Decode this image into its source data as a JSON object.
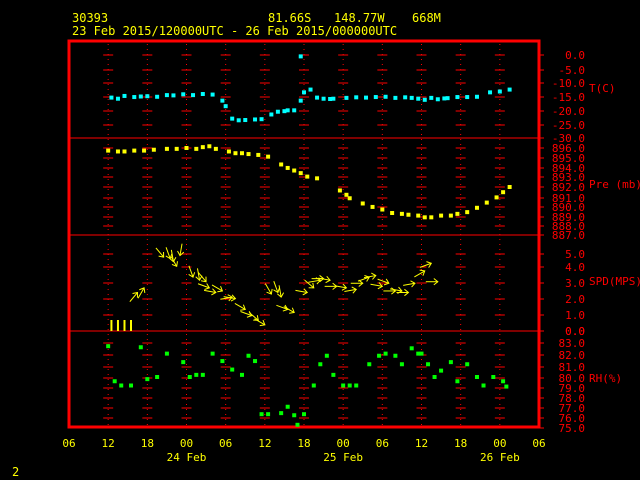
{
  "header": {
    "station_id": "30393",
    "lat": "81.66S",
    "lon": "148.77W",
    "elev": "668M",
    "time_range": "23 Feb 2015/120000UTC - 26 Feb 2015/000000UTC"
  },
  "footer": {
    "page_number": "2"
  },
  "colors": {
    "axes": "#ff0000",
    "text": "#ffff00",
    "temperature": "#00ffff",
    "pressure": "#ffff00",
    "wind": "#ffff00",
    "rh": "#00ff00"
  },
  "chart_data": {
    "type": "multi-panel time series",
    "x_axis": {
      "tick_labels": [
        "06",
        "12",
        "18",
        "00",
        "06",
        "12",
        "18",
        "00",
        "06",
        "12",
        "18",
        "00",
        "06"
      ],
      "day_labels": [
        "24 Feb",
        "25 Feb",
        "26 Feb"
      ]
    },
    "panels": [
      {
        "name": "temperature",
        "label": "T(C)",
        "ylim": [
          -30,
          0
        ],
        "tick_labels": [
          "0.0",
          "-5.0",
          "-10.0",
          "-15.0",
          "-20.0",
          "-25.0",
          "-30.0"
        ],
        "points": [
          [
            12.5,
            -15.4
          ],
          [
            13.5,
            -15.8
          ],
          [
            14.5,
            -14.8
          ],
          [
            16,
            -15.2
          ],
          [
            17,
            -15.0
          ],
          [
            18,
            -14.9
          ],
          [
            19.5,
            -15.1
          ],
          [
            21,
            -14.5
          ],
          [
            22,
            -14.6
          ],
          [
            23.5,
            -14.2
          ],
          [
            25,
            -14.5
          ],
          [
            26.5,
            -14.1
          ],
          [
            28,
            -14.3
          ],
          [
            29.5,
            -16.5
          ],
          [
            30,
            -18.5
          ],
          [
            31,
            -23
          ],
          [
            32,
            -23.6
          ],
          [
            33,
            -23.5
          ],
          [
            34.5,
            -23.3
          ],
          [
            35.5,
            -23.2
          ],
          [
            37,
            -21.5
          ],
          [
            38,
            -20.5
          ],
          [
            39,
            -20.3
          ],
          [
            39.5,
            -20
          ],
          [
            40.5,
            -20
          ],
          [
            41.5,
            -16.5
          ],
          [
            42,
            -13.5
          ],
          [
            43,
            -12.5
          ],
          [
            44,
            -15.4
          ],
          [
            45,
            -15.8
          ],
          [
            46,
            -15.9
          ],
          [
            46.5,
            -15.8
          ],
          [
            48.5,
            -15.5
          ],
          [
            50,
            -15.3
          ],
          [
            51.5,
            -15.4
          ],
          [
            53,
            -15.2
          ],
          [
            54.5,
            -15.1
          ],
          [
            56,
            -15.5
          ],
          [
            57.5,
            -15.3
          ],
          [
            58.5,
            -15.5
          ],
          [
            59.5,
            -15.8
          ],
          [
            60.5,
            -16.2
          ],
          [
            61.5,
            -15.5
          ],
          [
            62.5,
            -16.0
          ],
          [
            63.5,
            -15.7
          ],
          [
            64,
            -15.6
          ],
          [
            65.5,
            -15.2
          ],
          [
            67,
            -15.2
          ],
          [
            68.5,
            -15.1
          ],
          [
            70.5,
            -13.5
          ],
          [
            72,
            -13.2
          ],
          [
            73.5,
            -12.5
          ],
          [
            41.5,
            -0.5
          ]
        ]
      },
      {
        "name": "pressure",
        "label": "Pre (mb)",
        "ylim": [
          887,
          896
        ],
        "tick_labels": [
          "896.0",
          "895.0",
          "894.0",
          "893.0",
          "892.0",
          "891.0",
          "890.0",
          "889.0",
          "888.0",
          "887.0"
        ],
        "points": [
          [
            12,
            895.7
          ],
          [
            13.5,
            895.6
          ],
          [
            14.5,
            895.6
          ],
          [
            16,
            895.7
          ],
          [
            17.5,
            895.7
          ],
          [
            19,
            895.8
          ],
          [
            21,
            895.9
          ],
          [
            22.5,
            895.9
          ],
          [
            24,
            896.0
          ],
          [
            25.5,
            895.9
          ],
          [
            26.5,
            896.1
          ],
          [
            27.5,
            896.2
          ],
          [
            28.5,
            895.9
          ],
          [
            30.5,
            895.6
          ],
          [
            31.5,
            895.4
          ],
          [
            32.5,
            895.4
          ],
          [
            33.5,
            895.3
          ],
          [
            35,
            895.2
          ],
          [
            36.5,
            895.0
          ],
          [
            38.5,
            894.1
          ],
          [
            39.5,
            893.7
          ],
          [
            40.5,
            893.4
          ],
          [
            41.5,
            893.1
          ],
          [
            42.5,
            892.7
          ],
          [
            44,
            892.5
          ],
          [
            47.5,
            891.1
          ],
          [
            48.5,
            890.6
          ],
          [
            49,
            890.2
          ],
          [
            51,
            889.6
          ],
          [
            52.5,
            889.2
          ],
          [
            54,
            888.9
          ],
          [
            55.5,
            888.5
          ],
          [
            57,
            888.4
          ],
          [
            58,
            888.3
          ],
          [
            59.5,
            888.2
          ],
          [
            60.5,
            888.0
          ],
          [
            61.5,
            888.0
          ],
          [
            63,
            888.2
          ],
          [
            64.5,
            888.2
          ],
          [
            65.5,
            888.4
          ],
          [
            67,
            888.6
          ],
          [
            68.5,
            889.1
          ],
          [
            70,
            889.7
          ],
          [
            71.5,
            890.3
          ],
          [
            72.5,
            890.9
          ],
          [
            73.5,
            891.5
          ]
        ]
      },
      {
        "name": "wind",
        "label": "SPD(MPS)",
        "ylim": [
          0,
          5
        ],
        "tick_labels": [
          "5.0",
          "4.0",
          "3.0",
          "2.0",
          "1.0",
          "0.0"
        ],
        "barbs": [
          [
            12.5,
            0.0,
            0
          ],
          [
            13.5,
            0.0,
            0
          ],
          [
            14.5,
            0.0,
            0
          ],
          [
            15.5,
            0.0,
            0
          ],
          [
            16.5,
            2.5,
            220
          ],
          [
            17.5,
            2.8,
            210
          ],
          [
            20.5,
            4.8,
            320
          ],
          [
            21.5,
            4.7,
            340
          ],
          [
            22,
            4.5,
            350
          ],
          [
            22.5,
            4.2,
            330
          ],
          [
            23,
            4.9,
            10
          ],
          [
            25,
            3.5,
            340
          ],
          [
            26,
            3.3,
            350
          ],
          [
            27,
            3.2,
            320
          ],
          [
            27.5,
            2.8,
            290
          ],
          [
            28.5,
            2.5,
            280
          ],
          [
            29.5,
            2.6,
            300
          ],
          [
            31,
            2.2,
            260
          ],
          [
            31.5,
            2.1,
            280
          ],
          [
            33,
            1.4,
            300
          ],
          [
            34,
            1.0,
            290
          ],
          [
            35,
            0.7,
            310
          ],
          [
            36,
            0.4,
            300
          ],
          [
            37,
            2.4,
            330
          ],
          [
            38,
            2.5,
            340
          ],
          [
            38.5,
            2.2,
            350
          ],
          [
            39.5,
            1.4,
            290
          ],
          [
            40.5,
            1.2,
            300
          ],
          [
            42.5,
            2.5,
            280
          ],
          [
            43.5,
            2.8,
            310
          ],
          [
            44.5,
            3.3,
            260
          ],
          [
            45,
            3.4,
            270
          ],
          [
            46,
            3.3,
            280
          ],
          [
            47,
            2.9,
            270
          ],
          [
            48.5,
            2.8,
            280
          ],
          [
            50,
            2.7,
            260
          ],
          [
            51,
            3.1,
            270
          ],
          [
            52,
            3.5,
            250
          ],
          [
            53,
            3.6,
            260
          ],
          [
            54,
            2.9,
            280
          ],
          [
            55,
            3.1,
            290
          ],
          [
            56,
            2.6,
            270
          ],
          [
            57,
            2.6,
            280
          ],
          [
            58,
            2.5,
            270
          ],
          [
            59,
            3.1,
            260
          ],
          [
            60.5,
            3.9,
            240
          ],
          [
            61.5,
            4.4,
            250
          ],
          [
            62.5,
            3.2,
            270
          ]
        ]
      },
      {
        "name": "rh",
        "label": "RH(%)",
        "ylim": [
          75,
          83
        ],
        "tick_labels": [
          "0.0",
          "83.0",
          "82.0",
          "81.0",
          "80.0",
          "79.0",
          "78.0",
          "77.0",
          "76.0",
          "75.0"
        ],
        "points": [
          [
            12,
            82.7
          ],
          [
            13,
            79.4
          ],
          [
            14,
            79.0
          ],
          [
            15.5,
            79.0
          ],
          [
            17,
            82.6
          ],
          [
            18,
            79.6
          ],
          [
            19.5,
            79.8
          ],
          [
            21,
            82.0
          ],
          [
            23.5,
            81.2
          ],
          [
            24.5,
            79.8
          ],
          [
            25.5,
            80.0
          ],
          [
            26.5,
            80.0
          ],
          [
            28,
            82.0
          ],
          [
            29.5,
            81.3
          ],
          [
            31,
            80.5
          ],
          [
            32.5,
            80.0
          ],
          [
            33.5,
            81.8
          ],
          [
            34.5,
            81.3
          ],
          [
            35.5,
            76.3
          ],
          [
            36.5,
            76.3
          ],
          [
            38.5,
            76.4
          ],
          [
            39.5,
            77.0
          ],
          [
            40.5,
            76.2
          ],
          [
            41,
            75.3
          ],
          [
            42,
            76.3
          ],
          [
            43.5,
            79.0
          ],
          [
            44.5,
            81.0
          ],
          [
            45.5,
            81.8
          ],
          [
            46.5,
            80.0
          ],
          [
            48,
            79.0
          ],
          [
            49,
            79.0
          ],
          [
            50,
            79.0
          ],
          [
            52,
            81.0
          ],
          [
            53.5,
            81.8
          ],
          [
            54.5,
            82.0
          ],
          [
            56,
            81.8
          ],
          [
            57,
            81.0
          ],
          [
            58.5,
            82.5
          ],
          [
            59.5,
            82.0
          ],
          [
            60,
            82.0
          ],
          [
            61,
            81.0
          ],
          [
            62,
            79.8
          ],
          [
            63,
            80.4
          ],
          [
            64.5,
            81.2
          ],
          [
            65.5,
            79.4
          ],
          [
            67,
            81.0
          ],
          [
            68.5,
            79.8
          ],
          [
            69.5,
            79.0
          ],
          [
            71,
            79.8
          ],
          [
            72.5,
            79.4
          ],
          [
            73,
            78.9
          ]
        ]
      }
    ]
  }
}
